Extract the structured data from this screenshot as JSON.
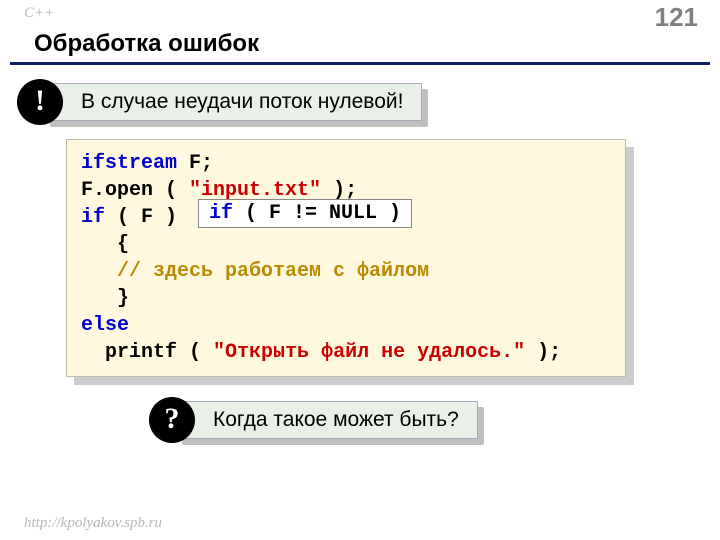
{
  "header": {
    "lang": "C++",
    "page_number": "121",
    "title": "Обработка ошибок"
  },
  "callout1": {
    "badge": "!",
    "text": "В случае неудачи поток нулевой!"
  },
  "code": {
    "l1_kw": "ifstream",
    "l1_rest": " F;",
    "l2_pre": "F.open",
    "l2_paren_open": " ( ",
    "l2_str": "\"input.txt\"",
    "l2_paren_close": " );",
    "l3_kw": "if",
    "l3_rest": " ( F )",
    "l4": "   {",
    "l5_indent": "   ",
    "l5_cmt": "// здесь работаем с файлом",
    "l6": "   }",
    "l7_kw": "else",
    "l8_indent": "  ",
    "l8_fn": "printf",
    "l8_paren_open": " ( ",
    "l8_str": "\"Открыть файл не удалось.\"",
    "l8_paren_close": " );",
    "annot_kw": "if",
    "annot_rest": " ( F != NULL )"
  },
  "callout2": {
    "badge": "?",
    "text": "Когда такое может быть?"
  },
  "footer": {
    "url": "http://kpolyakov.spb.ru"
  }
}
